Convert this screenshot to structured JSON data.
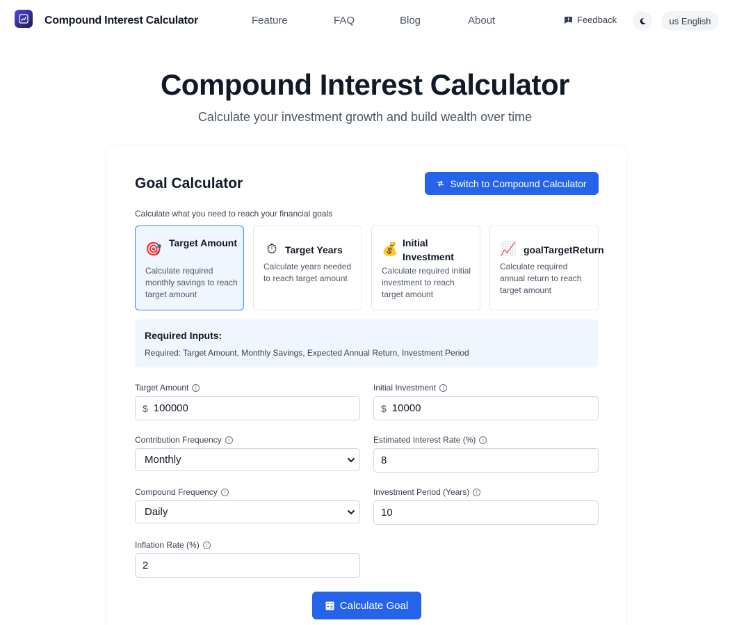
{
  "header": {
    "brand": "Compound Interest Calculator",
    "nav": [
      "Feature",
      "FAQ",
      "Blog",
      "About"
    ],
    "feedback": "Feedback",
    "language": "us English"
  },
  "hero": {
    "title": "Compound Interest Calculator",
    "subtitle": "Calculate your investment growth and build wealth over time"
  },
  "calculator": {
    "title": "Goal Calculator",
    "switch_label": "Switch to Compound Calculator",
    "description": "Calculate what you need to reach your financial goals",
    "modes": [
      {
        "name": "Target Amount",
        "desc": "Calculate required monthly savings to reach target amount",
        "icon": "target-icon"
      },
      {
        "name": "Target Years",
        "desc": "Calculate years needed to reach target amount",
        "icon": "stopwatch-icon"
      },
      {
        "name": "Initial Investment",
        "desc": "Calculate required initial investment to reach target amount",
        "icon": "money-bag-icon"
      },
      {
        "name": "goalTargetReturn",
        "desc": "Calculate required annual return to reach target amount",
        "icon": "chart-increasing-icon"
      }
    ],
    "required_title": "Required Inputs:",
    "required_text": "Required: Target Amount, Monthly Savings, Expected Annual Return, Investment Period",
    "fields": {
      "target_amount": {
        "label": "Target Amount",
        "prefix": "$",
        "value": "100000"
      },
      "initial_investment": {
        "label": "Initial Investment",
        "prefix": "$",
        "value": "10000"
      },
      "contribution_frequency": {
        "label": "Contribution Frequency",
        "value": "Monthly"
      },
      "interest_rate": {
        "label": "Estimated Interest Rate (%)",
        "value": "8"
      },
      "compound_frequency": {
        "label": "Compound Frequency",
        "value": "Daily"
      },
      "investment_period": {
        "label": "Investment Period (Years)",
        "value": "10"
      },
      "inflation_rate": {
        "label": "Inflation Rate (%)",
        "value": "2"
      }
    },
    "calculate_label": "Calculate Goal"
  },
  "colors": {
    "primary": "#2563eb",
    "active_card_bg": "#eff6ff",
    "active_card_border": "#3b82f6"
  }
}
